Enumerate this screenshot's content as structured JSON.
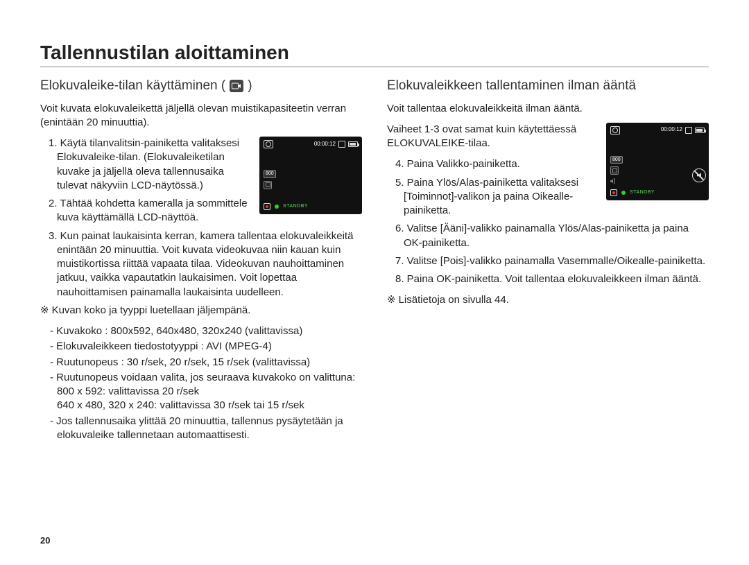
{
  "title": "Tallennustilan aloittaminen",
  "page_number": "20",
  "left": {
    "subtitle": "Elokuvaleike-tilan käyttäminen (",
    "subtitle_after": ")",
    "intro": "Voit kuvata elokuvaleikettä jäljellä olevan muistikapasiteetin verran (enintään 20 minuuttia).",
    "steps": [
      "1. Käytä tilanvalitsin-painiketta valitaksesi Elokuvaleike-tilan. (Elokuvaleiketilan kuvake ja jäljellä oleva tallennusaika tulevat näkyviin LCD-näytössä.)",
      "2. Tähtää kohdetta kameralla ja sommittele kuva käyttämällä LCD-näyttöä.",
      "3. Kun painat laukaisinta kerran, kamera tallentaa elokuvaleikkeitä enintään 20 minuuttia. Voit kuvata videokuvaa niin kauan kuin muistikortissa riittää vapaata tilaa. Videokuvan nauhoittaminen jatkuu, vaikka vapautatkin laukaisimen. Voit lopettaa nauhoittamisen painamalla laukaisinta uudelleen."
    ],
    "note_sym": "※",
    "note_heading": "Kuvan koko ja tyyppi luetellaan jäljempänä.",
    "bullets": [
      "- Kuvakoko : 800x592, 640x480, 320x240 (valittavissa)",
      "- Elokuvaleikkeen tiedostotyyppi : AVI (MPEG-4)",
      "- Ruutunopeus : 30 r/sek, 20 r/sek, 15 r/sek (valittavissa)",
      "- Ruutunopeus voidaan valita, jos seuraava kuvakoko on valittuna: 800 x 592: valittavissa 20 r/sek\n640 x 480, 320 x 240: valittavissa 30 r/sek tai 15 r/sek",
      "- Jos tallennusaika ylittää 20 minuuttia, tallennus pysäytetään ja elokuvaleike tallennetaan automaattisesti."
    ],
    "lcd": {
      "time": "00:00:12",
      "size": "800",
      "standby": "STANDBY"
    }
  },
  "right": {
    "subtitle": "Elokuvaleikkeen tallentaminen ilman ääntä",
    "intro": "Voit tallentaa elokuvaleikkeitä ilman ääntä.",
    "pre_steps": "Vaiheet 1-3 ovat samat kuin käytettäessä ELOKUVALEIKE-tilaa.",
    "steps": [
      "4. Paina Valikko-painiketta.",
      "5. Paina Ylös/Alas-painiketta valitaksesi [Toiminnot]-valikon ja paina Oikealle-painiketta.",
      "6. Valitse [Ääni]-valikko painamalla Ylös/Alas-painiketta ja paina OK-painiketta.",
      "7. Valitse [Pois]-valikko painamalla Vasemmalle/Oikealle-painiketta.",
      "8. Paina OK-painiketta. Voit tallentaa elokuvaleikkeen ilman ääntä."
    ],
    "footnote_sym": "※",
    "footnote": "Lisätietoja on sivulla 44.",
    "lcd": {
      "time": "00:00:12",
      "size": "800",
      "standby": "STANDBY"
    }
  }
}
